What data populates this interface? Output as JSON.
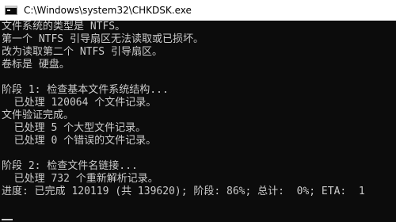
{
  "window": {
    "title": "C:\\Windows\\system32\\CHKDSK.exe",
    "icon": "console-icon"
  },
  "console": {
    "lines": [
      "文件系统的类型是 NTFS。",
      "第一个 NTFS 引导扇区无法读取或已损坏。",
      "改为读取第二个 NTFS 引导扇区。",
      "卷标是 硬盘。",
      "",
      "阶段 1: 检查基本文件系统结构...",
      "  已处理 120064 个文件记录。",
      "文件验证完成。",
      "  已处理 5 个大型文件记录。",
      "  已处理 0 个错误的文件记录。",
      "",
      "阶段 2: 检查文件名链接...",
      "  已处理 732 个重新解析记录。",
      "进度: 已完成 120119 (共 139620); 阶段: 86%; 总计:  0%; ETA:  1"
    ]
  },
  "colors": {
    "console_background": "#0c0c0c",
    "console_text": "#cccccc",
    "titlebar_background": "#ffffff"
  }
}
